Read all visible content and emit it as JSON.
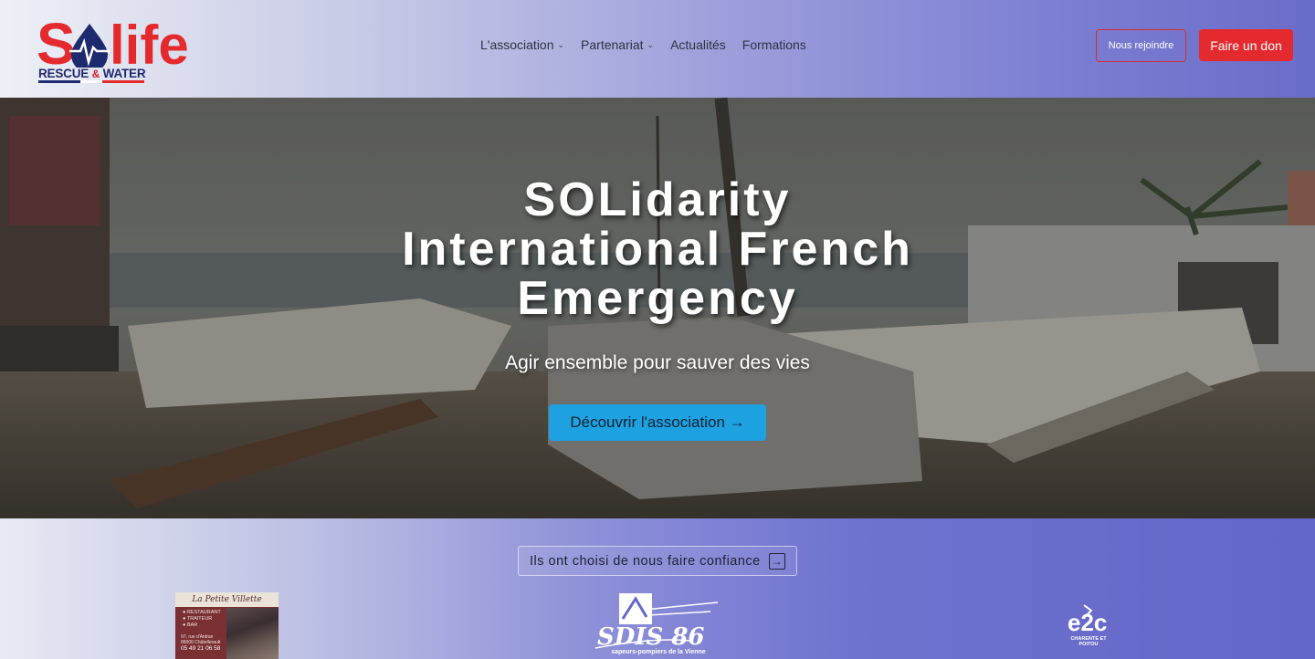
{
  "brand": {
    "name_part1": "S",
    "name_part2": "life",
    "tagline_part1": "RESCUE",
    "tagline_amp": "&",
    "tagline_part2": "WATER",
    "colors": {
      "red": "#e42a2e",
      "navy": "#1e2a6e",
      "blue": "#1ea1e0"
    }
  },
  "nav": {
    "items": [
      {
        "label": "L'association",
        "has_dropdown": true
      },
      {
        "label": "Partenariat",
        "has_dropdown": true
      },
      {
        "label": "Actualités",
        "has_dropdown": false
      },
      {
        "label": "Formations",
        "has_dropdown": false
      }
    ],
    "join_label": "Nous rejoindre",
    "donate_label": "Faire un don"
  },
  "hero": {
    "title_lines": [
      "SOLidarity",
      "International French",
      "Emergency"
    ],
    "subtitle": "Agir ensemble pour sauver des vies",
    "cta_label": "Découvrir l'association →"
  },
  "partners": {
    "trust_label": "Ils ont choisi de nous faire confiance",
    "trust_icon": "arrow-right-box-icon",
    "lpv": {
      "title": "La Petite Villette",
      "services": [
        "RESTAURANT",
        "TRAITEUR",
        "BAR"
      ],
      "address_line1": "97, rue d'Antran",
      "address_line2": "86000 Châtellerault",
      "phone": "05 49 21 06 58"
    },
    "sdis": {
      "logo_text": "SDIS 86",
      "subtitle": "sapeurs-pompiers de la Vienne"
    },
    "e2c": {
      "logo_text": "e2c",
      "subtitle_line1": "CHARENTE ET",
      "subtitle_line2": "POITOU"
    }
  }
}
